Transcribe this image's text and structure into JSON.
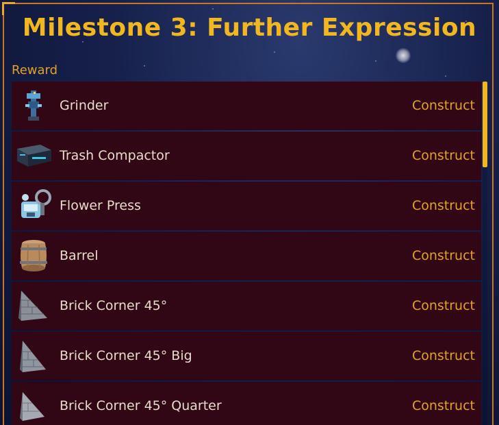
{
  "window": {
    "title": "Milestone 3: Further Expression"
  },
  "reward_section": {
    "label": "Reward",
    "items": [
      {
        "name": "Grinder",
        "action": "Construct",
        "icon": "grinder-icon"
      },
      {
        "name": "Trash Compactor",
        "action": "Construct",
        "icon": "trash-compactor-icon"
      },
      {
        "name": "Flower Press",
        "action": "Construct",
        "icon": "flower-press-icon"
      },
      {
        "name": "Barrel",
        "action": "Construct",
        "icon": "barrel-icon"
      },
      {
        "name": "Brick Corner 45°",
        "action": "Construct",
        "icon": "brick-corner-icon"
      },
      {
        "name": "Brick Corner 45° Big",
        "action": "Construct",
        "icon": "brick-corner-big-icon"
      },
      {
        "name": "Brick Corner 45° Quarter",
        "action": "Construct",
        "icon": "brick-corner-quarter-icon"
      }
    ]
  },
  "colors": {
    "accent": "#f2b61f",
    "frame": "#c9781e",
    "row_bg": "#310716",
    "row_text": "#e9dccd",
    "action_text": "#e3a22a"
  },
  "scroll": {
    "position_fraction": 0.0,
    "visible_fraction": 0.25
  }
}
